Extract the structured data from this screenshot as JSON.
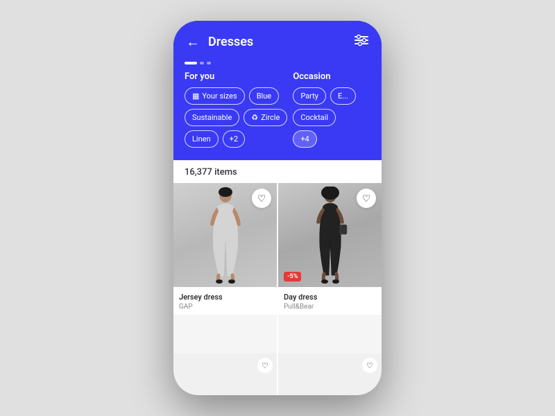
{
  "header": {
    "title": "Dresses",
    "back_label": "←",
    "filter_label": "⊟"
  },
  "dots": {
    "active": 1,
    "inactive": 2
  },
  "filter_columns": {
    "col1": {
      "label": "For you",
      "row1": [
        {
          "id": "sizes",
          "text": "Your sizes",
          "icon": "▦"
        },
        {
          "id": "blue",
          "text": "Blue"
        }
      ],
      "row2": [
        {
          "id": "sustainable",
          "text": "Sustainable"
        },
        {
          "id": "zircle",
          "text": "Zircle",
          "icon": "♻"
        }
      ],
      "row3": [
        {
          "id": "linen",
          "text": "Linen"
        },
        {
          "id": "more1",
          "text": "+2"
        }
      ]
    },
    "col2": {
      "label": "Occasion",
      "row1": [
        {
          "id": "party",
          "text": "Party"
        },
        {
          "id": "extra",
          "text": "E..."
        }
      ],
      "row2": [
        {
          "id": "cocktail",
          "text": "Cocktail"
        }
      ],
      "row3": [
        {
          "id": "more2",
          "text": "+4"
        }
      ]
    }
  },
  "items_count": "16,377 items",
  "products": [
    {
      "id": "p1",
      "name": "Jersey dress",
      "brand": "GAP",
      "has_discount": false,
      "figure_type": "light"
    },
    {
      "id": "p2",
      "name": "Day dress",
      "brand": "Pull&Bear",
      "has_discount": true,
      "discount_text": "-5%",
      "figure_type": "dark"
    }
  ]
}
